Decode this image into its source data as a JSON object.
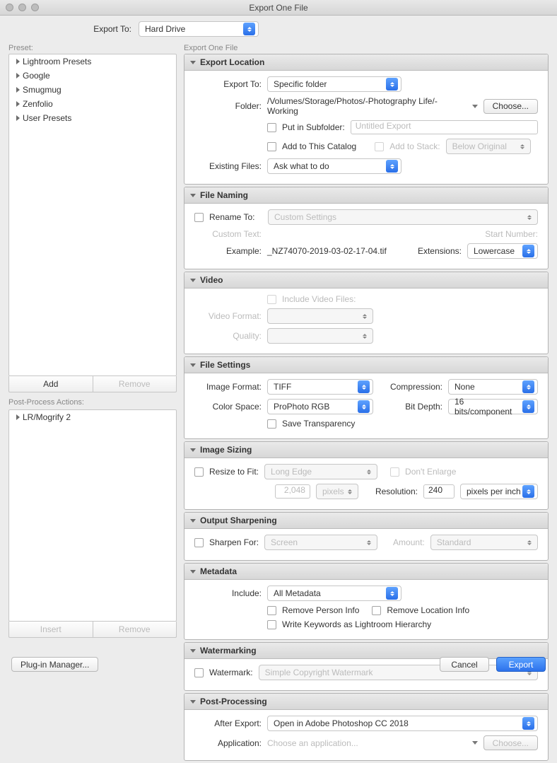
{
  "window": {
    "title": "Export One File"
  },
  "topbar": {
    "export_to_label": "Export To:",
    "export_to_value": "Hard Drive"
  },
  "left": {
    "preset_label": "Preset:",
    "presets": [
      "Lightroom Presets",
      "Google",
      "Smugmug",
      "Zenfolio",
      "User Presets"
    ],
    "add": "Add",
    "remove": "Remove",
    "post_label": "Post-Process Actions:",
    "post_items": [
      "LR/Mogrify 2"
    ],
    "insert": "Insert",
    "remove2": "Remove",
    "plugin_manager": "Plug-in Manager..."
  },
  "right": {
    "panel_label": "Export One File",
    "s_export_location": {
      "title": "Export Location",
      "export_to_label": "Export To:",
      "export_to_value": "Specific folder",
      "folder_label": "Folder:",
      "folder_value": "/Volumes/Storage/Photos/-Photography Life/-Working",
      "choose": "Choose...",
      "put_subfolder": "Put in Subfolder:",
      "subfolder_ph": "Untitled Export",
      "add_catalog": "Add to This Catalog",
      "add_stack": "Add to Stack:",
      "below_original": "Below Original",
      "existing_label": "Existing Files:",
      "existing_value": "Ask what to do"
    },
    "s_file_naming": {
      "title": "File Naming",
      "rename_to": "Rename To:",
      "rename_value": "Custom Settings",
      "custom_text": "Custom Text:",
      "start_number": "Start Number:",
      "example_label": "Example:",
      "example_value": "_NZ74070-2019-03-02-17-04.tif",
      "extensions_label": "Extensions:",
      "extensions_value": "Lowercase"
    },
    "s_video": {
      "title": "Video",
      "include": "Include Video Files:",
      "format_label": "Video Format:",
      "quality_label": "Quality:"
    },
    "s_file_settings": {
      "title": "File Settings",
      "image_format_label": "Image Format:",
      "image_format_value": "TIFF",
      "compression_label": "Compression:",
      "compression_value": "None",
      "color_space_label": "Color Space:",
      "color_space_value": "ProPhoto RGB",
      "bit_depth_label": "Bit Depth:",
      "bit_depth_value": "16 bits/component",
      "save_transparency": "Save Transparency"
    },
    "s_image_sizing": {
      "title": "Image Sizing",
      "resize_label": "Resize to Fit:",
      "resize_value": "Long Edge",
      "dont_enlarge": "Don't Enlarge",
      "size_value": "2,048",
      "size_unit": "pixels",
      "resolution_label": "Resolution:",
      "resolution_value": "240",
      "resolution_unit": "pixels per inch"
    },
    "s_sharpening": {
      "title": "Output Sharpening",
      "sharpen_for": "Sharpen For:",
      "sharpen_value": "Screen",
      "amount_label": "Amount:",
      "amount_value": "Standard"
    },
    "s_metadata": {
      "title": "Metadata",
      "include_label": "Include:",
      "include_value": "All Metadata",
      "remove_person": "Remove Person Info",
      "remove_location": "Remove Location Info",
      "write_keywords": "Write Keywords as Lightroom Hierarchy"
    },
    "s_watermark": {
      "title": "Watermarking",
      "watermark_label": "Watermark:",
      "watermark_value": "Simple Copyright Watermark"
    },
    "s_postproc": {
      "title": "Post-Processing",
      "after_export_label": "After Export:",
      "after_export_value": "Open in Adobe Photoshop CC 2018",
      "application_label": "Application:",
      "application_ph": "Choose an application...",
      "choose": "Choose..."
    }
  },
  "footer": {
    "cancel": "Cancel",
    "export": "Export"
  }
}
